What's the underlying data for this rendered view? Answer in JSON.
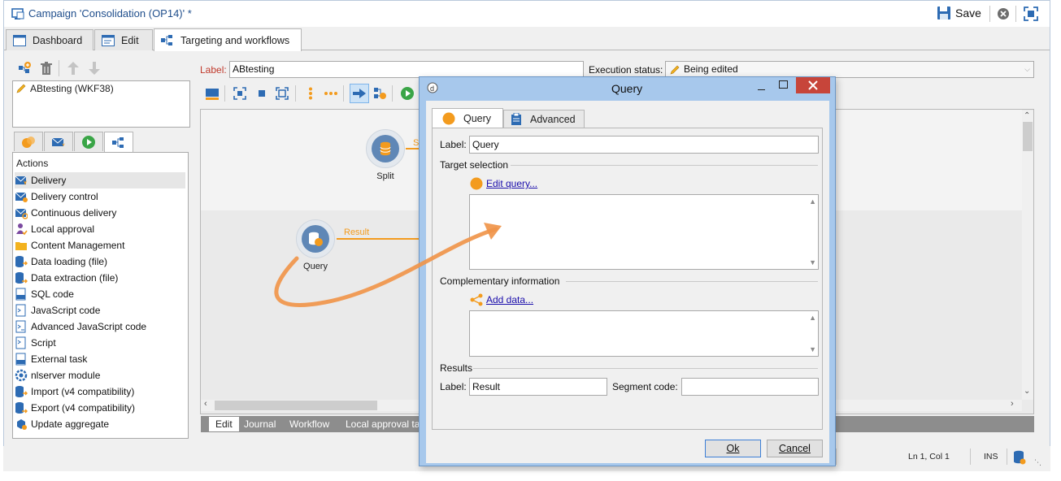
{
  "window": {
    "title": "Campaign 'Consolidation (OP14)' *",
    "save_label": "Save"
  },
  "tabs": [
    {
      "label": "Dashboard"
    },
    {
      "label": "Edit"
    },
    {
      "label": "Targeting and workflows"
    }
  ],
  "workflows": {
    "items": [
      {
        "label": "ABtesting (WKF38)"
      }
    ]
  },
  "workflow_header": {
    "label_caption": "Label:",
    "label_value": "ABtesting",
    "exec_caption": "Execution status:",
    "exec_value": "Being edited"
  },
  "actions": {
    "header": "Actions",
    "items": [
      {
        "label": "Delivery"
      },
      {
        "label": "Delivery control"
      },
      {
        "label": "Continuous delivery"
      },
      {
        "label": "Local approval"
      },
      {
        "label": "Content Management"
      },
      {
        "label": "Data loading (file)"
      },
      {
        "label": "Data extraction (file)"
      },
      {
        "label": "SQL code"
      },
      {
        "label": "JavaScript code"
      },
      {
        "label": "Advanced JavaScript code"
      },
      {
        "label": "Script"
      },
      {
        "label": "External task"
      },
      {
        "label": "nlserver module"
      },
      {
        "label": "Import (v4 compatibility)"
      },
      {
        "label": "Export (v4 compatibility)"
      },
      {
        "label": "Update aggregate"
      }
    ]
  },
  "canvas": {
    "nodes": [
      {
        "label": "Split"
      },
      {
        "label": "Query"
      }
    ],
    "transition_label": "Result",
    "split_transition_partial": "S"
  },
  "bottom_tabs": [
    {
      "label": "Edit"
    },
    {
      "label": "Journal"
    },
    {
      "label": "Workflow"
    },
    {
      "label": "Local approval ta"
    }
  ],
  "statusbar": {
    "position": "Ln 1, Col 1",
    "mode": "INS"
  },
  "dialog": {
    "title": "Query",
    "tabs": [
      {
        "label": "Query"
      },
      {
        "label": "Advanced"
      }
    ],
    "label_caption": "Label:",
    "label_value": "Query",
    "target_section": "Target selection",
    "edit_query_link": "Edit query...",
    "complementary_section": "Complementary information",
    "add_data_link": "Add data...",
    "results_section": "Results",
    "result_label_caption": "Label:",
    "result_label_value": "Result",
    "segment_caption": "Segment code:",
    "segment_value": "",
    "ok_label": "Ok",
    "cancel_label": "Cancel"
  },
  "colors": {
    "accent_orange": "#f39b1e",
    "node_blue": "#5f87b6",
    "title_blue": "#1f4e8c",
    "dialog_frame": "#a7c8ec",
    "close_red": "#c7453a"
  }
}
